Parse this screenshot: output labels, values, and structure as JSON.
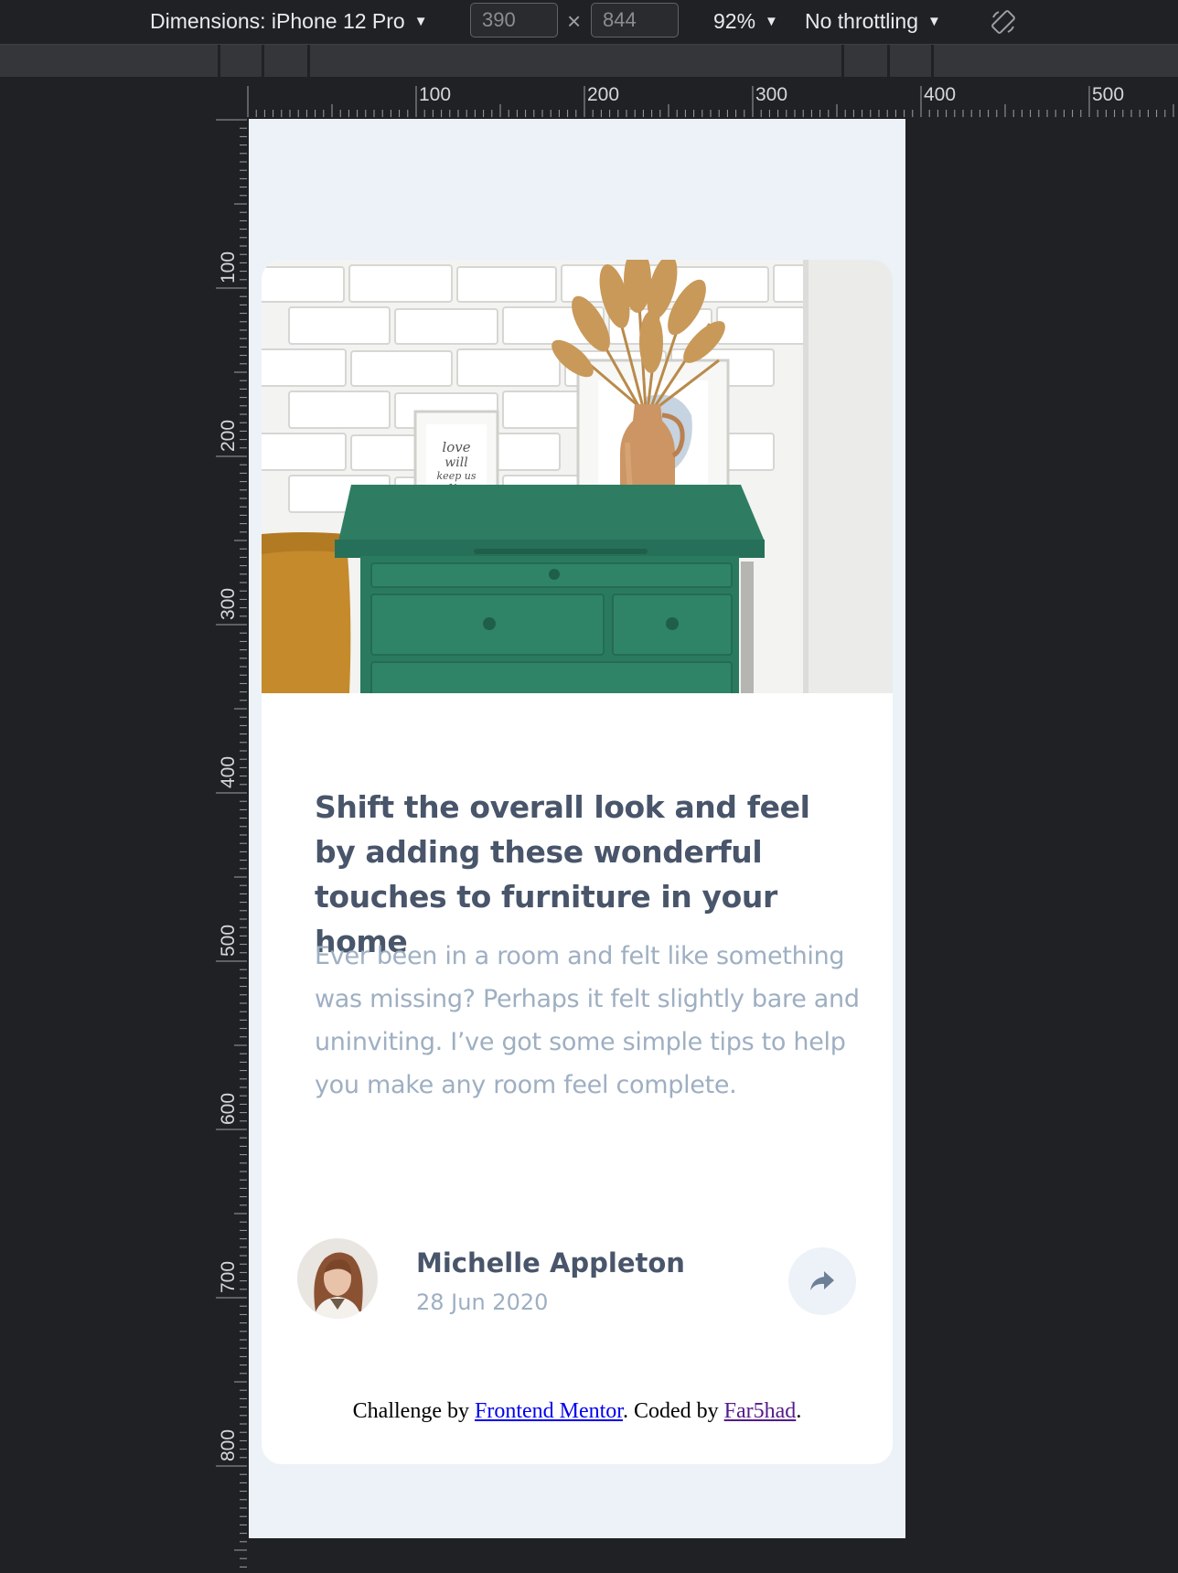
{
  "devtools": {
    "dimensions_label": "Dimensions: iPhone 12 Pro",
    "width_value": "390",
    "height_value": "844",
    "zoom": "92%",
    "throttling": "No throttling",
    "ruler_h_labels": [
      "100",
      "200",
      "300",
      "400",
      "500"
    ],
    "ruler_v_labels": [
      "100",
      "200",
      "300",
      "400",
      "500",
      "600",
      "700",
      "800"
    ]
  },
  "card": {
    "image_alt": "Green drawer with a vase of dried grass and framed prints",
    "title": "Shift the overall look and feel by adding these wonderful touches to furniture in your home",
    "excerpt": "Ever been in a room and felt like something was missing? Perhaps it felt slightly bare and uninviting. I’ve got some simple tips to help you make any room feel complete.",
    "author": {
      "name": "Michelle Appleton",
      "date": "28 Jun 2020"
    },
    "share_icon": "share-arrow-icon"
  },
  "attribution": {
    "prefix": "Challenge by ",
    "link1": "Frontend Mentor",
    "middle": ". Coded by ",
    "link2": "Far5had",
    "suffix": "."
  },
  "colors": {
    "heading": "#48556a",
    "muted": "#9eafc2",
    "background": "#ecf2f8",
    "devtools_bg": "#202124"
  }
}
